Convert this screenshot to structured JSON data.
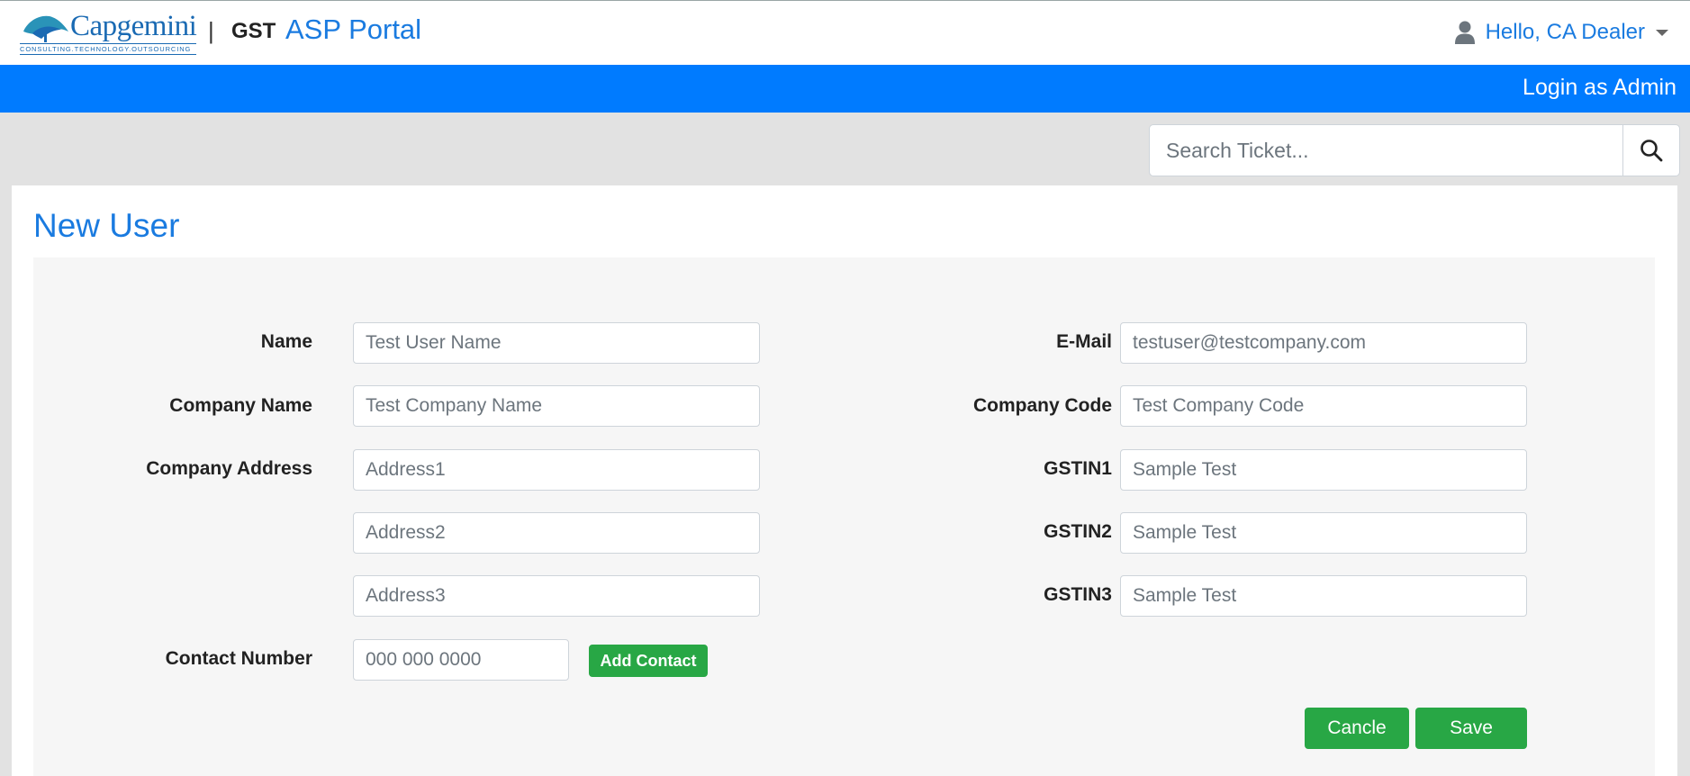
{
  "header": {
    "logo": {
      "word": "Capgemini",
      "tagline": "CONSULTING.TECHNOLOGY.OUTSOURCING"
    },
    "separator": "|",
    "gst_label": "GST",
    "portal_label": "ASP Portal",
    "user_greeting": "Hello, CA Dealer",
    "user_icon": "user-icon",
    "caret_icon": "caret-down-icon"
  },
  "nav": {
    "login_admin": "Login as Admin",
    "color": "#007bff"
  },
  "search": {
    "placeholder": "Search Ticket...",
    "value": "",
    "icon": "search-icon"
  },
  "page": {
    "title": "New User"
  },
  "form": {
    "left": {
      "name_label": "Name",
      "name_placeholder": "Test User Name",
      "company_name_label": "Company Name",
      "company_name_placeholder": "Test Company Name",
      "company_address_label": "Company Address",
      "address1_placeholder": "Address1",
      "address2_placeholder": "Address2",
      "address3_placeholder": "Address3",
      "contact_number_label": "Contact Number",
      "contact_number_placeholder": "000 000 0000",
      "add_contact_label": "Add Contact"
    },
    "right": {
      "email_label": "E-Mail",
      "email_placeholder": "testuser@testcompany.com",
      "company_code_label": "Company Code",
      "company_code_placeholder": "Test Company Code",
      "gstin1_label": "GSTIN1",
      "gstin1_placeholder": "Sample Test",
      "gstin2_label": "GSTIN2",
      "gstin2_placeholder": "Sample Test",
      "gstin3_label": "GSTIN3",
      "gstin3_placeholder": "Sample Test"
    },
    "actions": {
      "cancel_label": "Cancle",
      "save_label": "Save",
      "button_color": "#28a745"
    }
  }
}
